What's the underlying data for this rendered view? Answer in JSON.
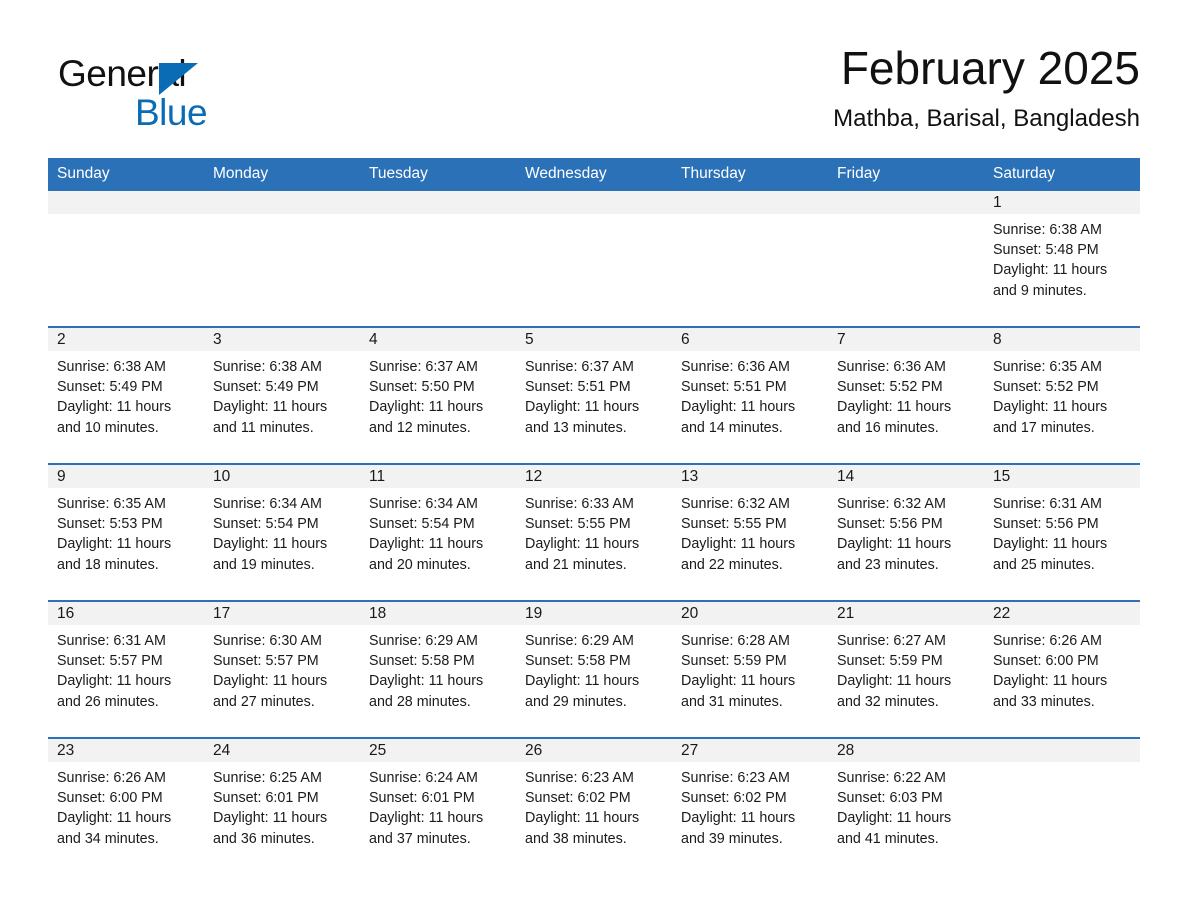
{
  "brand": {
    "name_part1": "General",
    "name_part2": "Blue"
  },
  "header": {
    "month_title": "February 2025",
    "location": "Mathba, Barisal, Bangladesh"
  },
  "colors": {
    "header_blue": "#2b71b8",
    "brand_blue": "#0a6cb4",
    "daynum_band": "#f2f2f2",
    "row_divider": "#2b71b8"
  },
  "calendar": {
    "weekday_headers": [
      "Sunday",
      "Monday",
      "Tuesday",
      "Wednesday",
      "Thursday",
      "Friday",
      "Saturday"
    ],
    "weeks": [
      [
        {
          "empty": true
        },
        {
          "empty": true
        },
        {
          "empty": true
        },
        {
          "empty": true
        },
        {
          "empty": true
        },
        {
          "empty": true
        },
        {
          "day": "1",
          "sunrise": "Sunrise: 6:38 AM",
          "sunset": "Sunset: 5:48 PM",
          "daylight": "Daylight: 11 hours and 9 minutes."
        }
      ],
      [
        {
          "day": "2",
          "sunrise": "Sunrise: 6:38 AM",
          "sunset": "Sunset: 5:49 PM",
          "daylight": "Daylight: 11 hours and 10 minutes."
        },
        {
          "day": "3",
          "sunrise": "Sunrise: 6:38 AM",
          "sunset": "Sunset: 5:49 PM",
          "daylight": "Daylight: 11 hours and 11 minutes."
        },
        {
          "day": "4",
          "sunrise": "Sunrise: 6:37 AM",
          "sunset": "Sunset: 5:50 PM",
          "daylight": "Daylight: 11 hours and 12 minutes."
        },
        {
          "day": "5",
          "sunrise": "Sunrise: 6:37 AM",
          "sunset": "Sunset: 5:51 PM",
          "daylight": "Daylight: 11 hours and 13 minutes."
        },
        {
          "day": "6",
          "sunrise": "Sunrise: 6:36 AM",
          "sunset": "Sunset: 5:51 PM",
          "daylight": "Daylight: 11 hours and 14 minutes."
        },
        {
          "day": "7",
          "sunrise": "Sunrise: 6:36 AM",
          "sunset": "Sunset: 5:52 PM",
          "daylight": "Daylight: 11 hours and 16 minutes."
        },
        {
          "day": "8",
          "sunrise": "Sunrise: 6:35 AM",
          "sunset": "Sunset: 5:52 PM",
          "daylight": "Daylight: 11 hours and 17 minutes."
        }
      ],
      [
        {
          "day": "9",
          "sunrise": "Sunrise: 6:35 AM",
          "sunset": "Sunset: 5:53 PM",
          "daylight": "Daylight: 11 hours and 18 minutes."
        },
        {
          "day": "10",
          "sunrise": "Sunrise: 6:34 AM",
          "sunset": "Sunset: 5:54 PM",
          "daylight": "Daylight: 11 hours and 19 minutes."
        },
        {
          "day": "11",
          "sunrise": "Sunrise: 6:34 AM",
          "sunset": "Sunset: 5:54 PM",
          "daylight": "Daylight: 11 hours and 20 minutes."
        },
        {
          "day": "12",
          "sunrise": "Sunrise: 6:33 AM",
          "sunset": "Sunset: 5:55 PM",
          "daylight": "Daylight: 11 hours and 21 minutes."
        },
        {
          "day": "13",
          "sunrise": "Sunrise: 6:32 AM",
          "sunset": "Sunset: 5:55 PM",
          "daylight": "Daylight: 11 hours and 22 minutes."
        },
        {
          "day": "14",
          "sunrise": "Sunrise: 6:32 AM",
          "sunset": "Sunset: 5:56 PM",
          "daylight": "Daylight: 11 hours and 23 minutes."
        },
        {
          "day": "15",
          "sunrise": "Sunrise: 6:31 AM",
          "sunset": "Sunset: 5:56 PM",
          "daylight": "Daylight: 11 hours and 25 minutes."
        }
      ],
      [
        {
          "day": "16",
          "sunrise": "Sunrise: 6:31 AM",
          "sunset": "Sunset: 5:57 PM",
          "daylight": "Daylight: 11 hours and 26 minutes."
        },
        {
          "day": "17",
          "sunrise": "Sunrise: 6:30 AM",
          "sunset": "Sunset: 5:57 PM",
          "daylight": "Daylight: 11 hours and 27 minutes."
        },
        {
          "day": "18",
          "sunrise": "Sunrise: 6:29 AM",
          "sunset": "Sunset: 5:58 PM",
          "daylight": "Daylight: 11 hours and 28 minutes."
        },
        {
          "day": "19",
          "sunrise": "Sunrise: 6:29 AM",
          "sunset": "Sunset: 5:58 PM",
          "daylight": "Daylight: 11 hours and 29 minutes."
        },
        {
          "day": "20",
          "sunrise": "Sunrise: 6:28 AM",
          "sunset": "Sunset: 5:59 PM",
          "daylight": "Daylight: 11 hours and 31 minutes."
        },
        {
          "day": "21",
          "sunrise": "Sunrise: 6:27 AM",
          "sunset": "Sunset: 5:59 PM",
          "daylight": "Daylight: 11 hours and 32 minutes."
        },
        {
          "day": "22",
          "sunrise": "Sunrise: 6:26 AM",
          "sunset": "Sunset: 6:00 PM",
          "daylight": "Daylight: 11 hours and 33 minutes."
        }
      ],
      [
        {
          "day": "23",
          "sunrise": "Sunrise: 6:26 AM",
          "sunset": "Sunset: 6:00 PM",
          "daylight": "Daylight: 11 hours and 34 minutes."
        },
        {
          "day": "24",
          "sunrise": "Sunrise: 6:25 AM",
          "sunset": "Sunset: 6:01 PM",
          "daylight": "Daylight: 11 hours and 36 minutes."
        },
        {
          "day": "25",
          "sunrise": "Sunrise: 6:24 AM",
          "sunset": "Sunset: 6:01 PM",
          "daylight": "Daylight: 11 hours and 37 minutes."
        },
        {
          "day": "26",
          "sunrise": "Sunrise: 6:23 AM",
          "sunset": "Sunset: 6:02 PM",
          "daylight": "Daylight: 11 hours and 38 minutes."
        },
        {
          "day": "27",
          "sunrise": "Sunrise: 6:23 AM",
          "sunset": "Sunset: 6:02 PM",
          "daylight": "Daylight: 11 hours and 39 minutes."
        },
        {
          "day": "28",
          "sunrise": "Sunrise: 6:22 AM",
          "sunset": "Sunset: 6:03 PM",
          "daylight": "Daylight: 11 hours and 41 minutes."
        },
        {
          "empty": true
        }
      ]
    ]
  }
}
